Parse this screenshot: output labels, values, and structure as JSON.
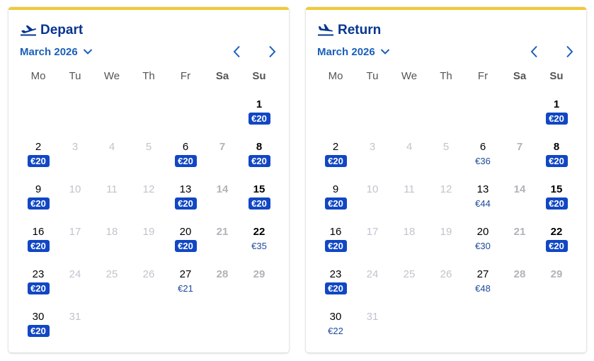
{
  "depart": {
    "title": "Depart",
    "month": "March 2026",
    "weekdays": [
      "Mo",
      "Tu",
      "We",
      "Th",
      "Fr",
      "Sa",
      "Su"
    ],
    "days": [
      {
        "day": "1",
        "col": 6,
        "row": 0,
        "price": "€20",
        "low": true,
        "available": true
      },
      {
        "day": "2",
        "col": 0,
        "row": 1,
        "price": "€20",
        "low": true,
        "available": true
      },
      {
        "day": "3",
        "col": 1,
        "row": 1,
        "available": false
      },
      {
        "day": "4",
        "col": 2,
        "row": 1,
        "available": false
      },
      {
        "day": "5",
        "col": 3,
        "row": 1,
        "available": false
      },
      {
        "day": "6",
        "col": 4,
        "row": 1,
        "price": "€20",
        "low": true,
        "available": true
      },
      {
        "day": "7",
        "col": 5,
        "row": 1,
        "available": false
      },
      {
        "day": "8",
        "col": 6,
        "row": 1,
        "price": "€20",
        "low": true,
        "available": true
      },
      {
        "day": "9",
        "col": 0,
        "row": 2,
        "price": "€20",
        "low": true,
        "available": true
      },
      {
        "day": "10",
        "col": 1,
        "row": 2,
        "available": false
      },
      {
        "day": "11",
        "col": 2,
        "row": 2,
        "available": false
      },
      {
        "day": "12",
        "col": 3,
        "row": 2,
        "available": false
      },
      {
        "day": "13",
        "col": 4,
        "row": 2,
        "price": "€20",
        "low": true,
        "available": true
      },
      {
        "day": "14",
        "col": 5,
        "row": 2,
        "available": false
      },
      {
        "day": "15",
        "col": 6,
        "row": 2,
        "price": "€20",
        "low": true,
        "available": true
      },
      {
        "day": "16",
        "col": 0,
        "row": 3,
        "price": "€20",
        "low": true,
        "available": true
      },
      {
        "day": "17",
        "col": 1,
        "row": 3,
        "available": false
      },
      {
        "day": "18",
        "col": 2,
        "row": 3,
        "available": false
      },
      {
        "day": "19",
        "col": 3,
        "row": 3,
        "available": false
      },
      {
        "day": "20",
        "col": 4,
        "row": 3,
        "price": "€20",
        "low": true,
        "available": true
      },
      {
        "day": "21",
        "col": 5,
        "row": 3,
        "available": false
      },
      {
        "day": "22",
        "col": 6,
        "row": 3,
        "price": "€35",
        "low": false,
        "available": true
      },
      {
        "day": "23",
        "col": 0,
        "row": 4,
        "price": "€20",
        "low": true,
        "available": true
      },
      {
        "day": "24",
        "col": 1,
        "row": 4,
        "available": false
      },
      {
        "day": "25",
        "col": 2,
        "row": 4,
        "available": false
      },
      {
        "day": "26",
        "col": 3,
        "row": 4,
        "available": false
      },
      {
        "day": "27",
        "col": 4,
        "row": 4,
        "price": "€21",
        "low": false,
        "available": true
      },
      {
        "day": "28",
        "col": 5,
        "row": 4,
        "available": false
      },
      {
        "day": "29",
        "col": 6,
        "row": 4,
        "available": false
      },
      {
        "day": "30",
        "col": 0,
        "row": 5,
        "price": "€20",
        "low": true,
        "available": true
      },
      {
        "day": "31",
        "col": 1,
        "row": 5,
        "available": false
      }
    ]
  },
  "return": {
    "title": "Return",
    "month": "March 2026",
    "weekdays": [
      "Mo",
      "Tu",
      "We",
      "Th",
      "Fr",
      "Sa",
      "Su"
    ],
    "days": [
      {
        "day": "1",
        "col": 6,
        "row": 0,
        "price": "€20",
        "low": true,
        "available": true
      },
      {
        "day": "2",
        "col": 0,
        "row": 1,
        "price": "€20",
        "low": true,
        "available": true
      },
      {
        "day": "3",
        "col": 1,
        "row": 1,
        "available": false
      },
      {
        "day": "4",
        "col": 2,
        "row": 1,
        "available": false
      },
      {
        "day": "5",
        "col": 3,
        "row": 1,
        "available": false
      },
      {
        "day": "6",
        "col": 4,
        "row": 1,
        "price": "€36",
        "low": false,
        "available": true
      },
      {
        "day": "7",
        "col": 5,
        "row": 1,
        "available": false
      },
      {
        "day": "8",
        "col": 6,
        "row": 1,
        "price": "€20",
        "low": true,
        "available": true
      },
      {
        "day": "9",
        "col": 0,
        "row": 2,
        "price": "€20",
        "low": true,
        "available": true
      },
      {
        "day": "10",
        "col": 1,
        "row": 2,
        "available": false
      },
      {
        "day": "11",
        "col": 2,
        "row": 2,
        "available": false
      },
      {
        "day": "12",
        "col": 3,
        "row": 2,
        "available": false
      },
      {
        "day": "13",
        "col": 4,
        "row": 2,
        "price": "€44",
        "low": false,
        "available": true
      },
      {
        "day": "14",
        "col": 5,
        "row": 2,
        "available": false
      },
      {
        "day": "15",
        "col": 6,
        "row": 2,
        "price": "€20",
        "low": true,
        "available": true
      },
      {
        "day": "16",
        "col": 0,
        "row": 3,
        "price": "€20",
        "low": true,
        "available": true
      },
      {
        "day": "17",
        "col": 1,
        "row": 3,
        "available": false
      },
      {
        "day": "18",
        "col": 2,
        "row": 3,
        "available": false
      },
      {
        "day": "19",
        "col": 3,
        "row": 3,
        "available": false
      },
      {
        "day": "20",
        "col": 4,
        "row": 3,
        "price": "€30",
        "low": false,
        "available": true
      },
      {
        "day": "21",
        "col": 5,
        "row": 3,
        "available": false
      },
      {
        "day": "22",
        "col": 6,
        "row": 3,
        "price": "€20",
        "low": true,
        "available": true
      },
      {
        "day": "23",
        "col": 0,
        "row": 4,
        "price": "€20",
        "low": true,
        "available": true
      },
      {
        "day": "24",
        "col": 1,
        "row": 4,
        "available": false
      },
      {
        "day": "25",
        "col": 2,
        "row": 4,
        "available": false
      },
      {
        "day": "26",
        "col": 3,
        "row": 4,
        "available": false
      },
      {
        "day": "27",
        "col": 4,
        "row": 4,
        "price": "€48",
        "low": false,
        "available": true
      },
      {
        "day": "28",
        "col": 5,
        "row": 4,
        "available": false
      },
      {
        "day": "29",
        "col": 6,
        "row": 4,
        "available": false
      },
      {
        "day": "30",
        "col": 0,
        "row": 5,
        "price": "€22",
        "low": false,
        "available": true
      },
      {
        "day": "31",
        "col": 1,
        "row": 5,
        "available": false
      }
    ]
  },
  "icons": {
    "depart_icon": "plane-takeoff-icon",
    "return_icon": "plane-landing-icon",
    "month_dropdown": "chevron-down-icon",
    "prev": "chevron-left-icon",
    "next": "chevron-right-icon"
  },
  "colors": {
    "accent_bar": "#f1c933",
    "title": "#073590",
    "link": "#1b5fb8",
    "low_price_badge": "#1147c4",
    "price_text": "#1b4a9a"
  }
}
